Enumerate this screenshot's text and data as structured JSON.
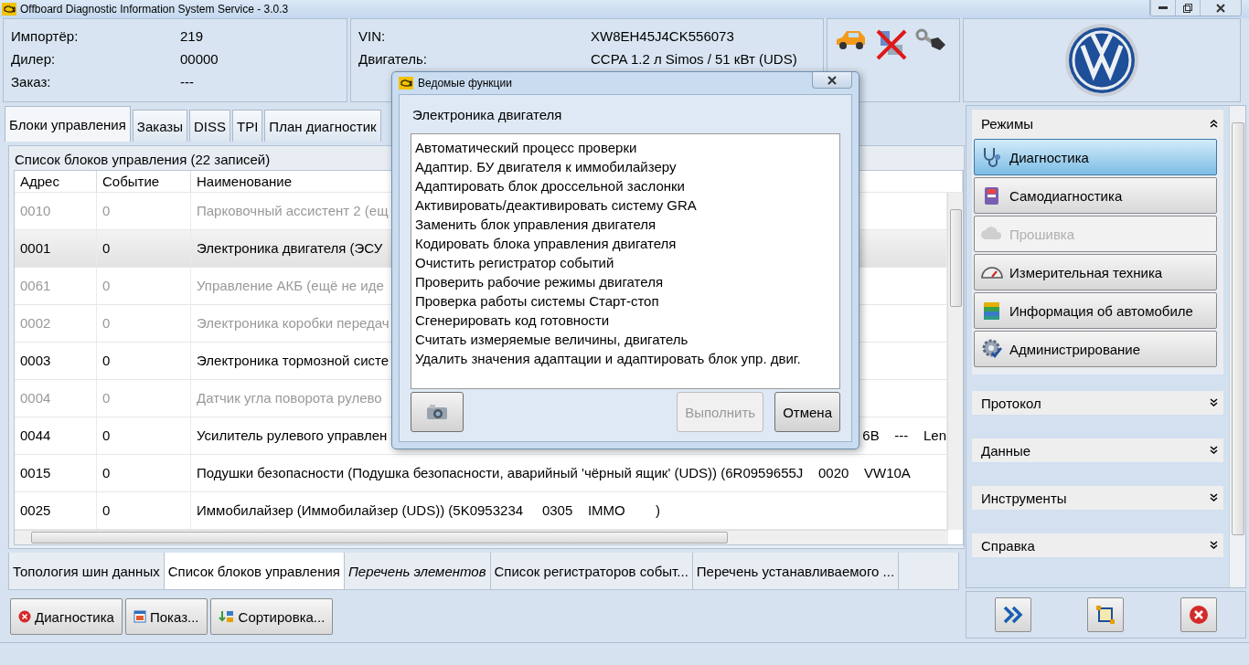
{
  "window": {
    "title": "Offboard Diagnostic Information System Service - 3.0.3"
  },
  "info": [
    {
      "label": "Импортёр:",
      "value": "219"
    },
    {
      "label": "Дилер:",
      "value": "00000"
    },
    {
      "label": "Заказ:",
      "value": "---"
    }
  ],
  "vehicle": [
    {
      "label": "VIN:",
      "value": "XW8EH45J4CK556073"
    },
    {
      "label": "Двигатель:",
      "value": "CCPA 1.2 л Simos / 51 кВт (UDS)"
    }
  ],
  "tabs": [
    {
      "label": "Блоки управления",
      "selected": true
    },
    {
      "label": "Заказы",
      "selected": false
    },
    {
      "label": "DISS",
      "selected": false
    },
    {
      "label": "TPI",
      "selected": false
    },
    {
      "label": "План диагностик",
      "selected": false
    }
  ],
  "list": {
    "title": "Список блоков управления (22 записей)",
    "columns": [
      "Адрес",
      "Событие",
      "Наименование"
    ],
    "rows": [
      {
        "address": "0010",
        "event": "0",
        "name": "Парковочный ассистент 2 (ещ",
        "inactive": true,
        "selected": false
      },
      {
        "address": "0001",
        "event": "0",
        "name": "Электроника двигателя (ЭСУ",
        "inactive": false,
        "selected": true
      },
      {
        "address": "0061",
        "event": "0",
        "name": "Управление АКБ (ещё не иде",
        "inactive": true,
        "selected": false
      },
      {
        "address": "0002",
        "event": "0",
        "name": "Электроника коробки передач",
        "inactive": true,
        "selected": false
      },
      {
        "address": "0003",
        "event": "0",
        "name": "Электроника тормозной систе",
        "inactive": false,
        "selected": false
      },
      {
        "address": "0004",
        "event": "0",
        "name": "Датчик угла поворота рулево",
        "inactive": true,
        "selected": false
      },
      {
        "address": "0044",
        "event": "0",
        "name": "Усилитель рулевого управлен",
        "tail": "6B    ---    Len",
        "inactive": false,
        "selected": false
      },
      {
        "address": "0015",
        "event": "0",
        "name": "Подушки безопасности (Подушка безопасности, аварийный 'чёрный ящик' (UDS)) (6R0959655J    0020    VW10A",
        "inactive": false,
        "selected": false
      },
      {
        "address": "0025",
        "event": "0",
        "name": "Иммобилайзер (Иммобилайзер (UDS)) (5K0953234     0305    IMMO        )",
        "inactive": false,
        "selected": false
      }
    ]
  },
  "bottom_tabs": [
    {
      "label": "Топология шин данных",
      "selected": false,
      "italic": false
    },
    {
      "label": "Список блоков управления",
      "selected": true,
      "italic": false
    },
    {
      "label": "Перечень элементов",
      "selected": false,
      "italic": true
    },
    {
      "label": "Список регистраторов событ...",
      "selected": false,
      "italic": false
    },
    {
      "label": "Перечень устанавливаемого ...",
      "selected": false,
      "italic": false
    }
  ],
  "actions": [
    {
      "label": "Диагностика"
    },
    {
      "label": "Показ..."
    },
    {
      "label": "Сортировка..."
    }
  ],
  "modes": {
    "title": "Режимы",
    "expanded": true,
    "items": [
      {
        "label": "Диагностика",
        "selected": true,
        "disabled": false
      },
      {
        "label": "Самодиагностика",
        "selected": false,
        "disabled": false
      },
      {
        "label": "Прошивка",
        "selected": false,
        "disabled": true
      },
      {
        "label": "Измерительная техника",
        "selected": false,
        "disabled": false
      },
      {
        "label": "Информация об автомобиле",
        "selected": false,
        "disabled": false
      },
      {
        "label": "Администрирование",
        "selected": false,
        "disabled": false
      }
    ]
  },
  "sections": [
    {
      "title": "Протокол",
      "expanded": false
    },
    {
      "title": "Данные",
      "expanded": false
    },
    {
      "title": "Инструменты",
      "expanded": false
    },
    {
      "title": "Справка",
      "expanded": false
    }
  ],
  "dialog": {
    "title": "Ведомые функции",
    "subtitle": "Электроника двигателя",
    "items": [
      "Автоматический процесс проверки",
      "Адаптир. БУ двигателя к иммобилайзеру",
      "Адаптировать блок дроссельной заслонки",
      "Активировать/деактивировать систему GRA",
      "Заменить блок управления двигателя",
      "Кодировать блока управления двигателя",
      "Очистить регистратор событий",
      "Проверить рабочие режимы двигателя",
      "Проверка работы системы Старт-стоп",
      "Сгенерировать код готовности",
      "Считать измеряемые величины, двигатель",
      "Удалить значения адаптации и адаптировать блок упр. двиг."
    ],
    "buttons": [
      {
        "label": "Выполнить",
        "disabled": true
      },
      {
        "label": "Отмена",
        "disabled": false
      }
    ]
  }
}
